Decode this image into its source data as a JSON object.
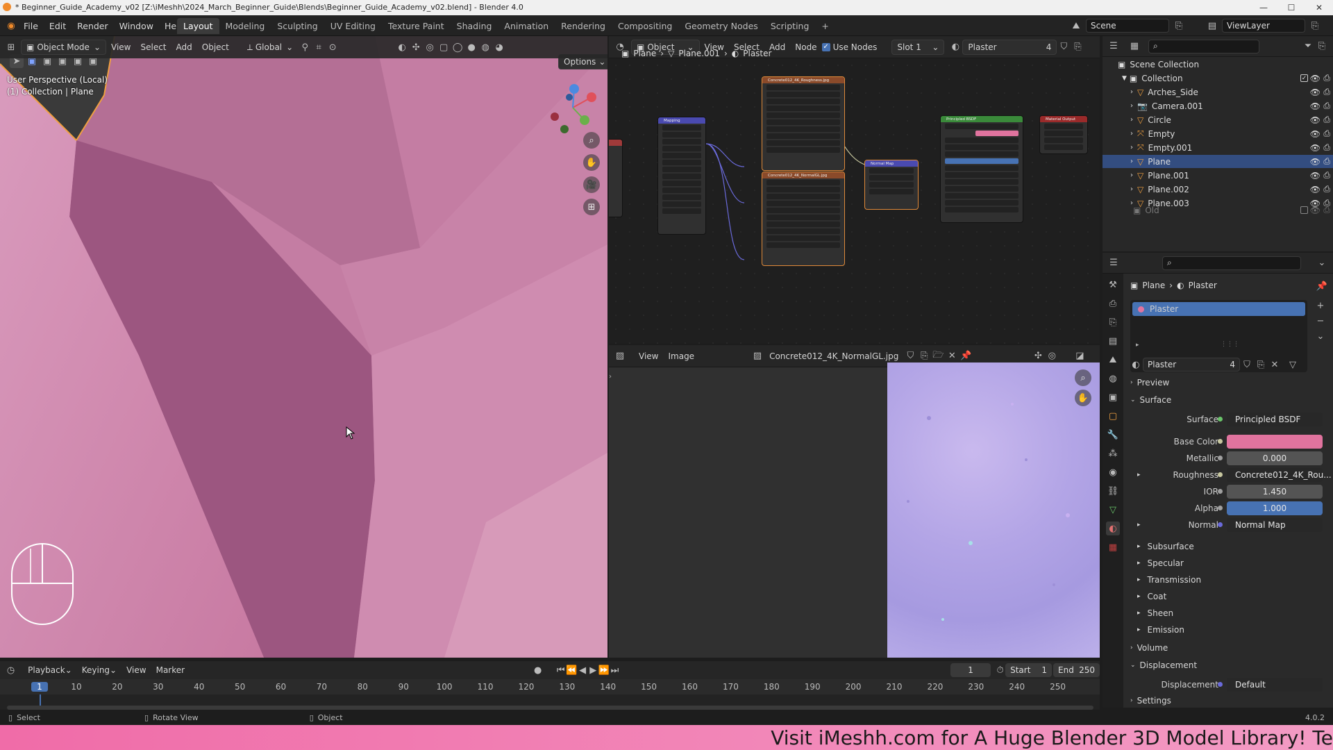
{
  "titlebar": {
    "text": "* Beginner_Guide_Academy_v02 [Z:\\iMeshh\\2024_March_Beginner_Guide\\Blends\\Beginner_Guide_Academy_v02.blend] - Blender 4.0"
  },
  "menu": [
    "File",
    "Edit",
    "Render",
    "Window",
    "Help"
  ],
  "workspaces": [
    "Layout",
    "Modeling",
    "Sculpting",
    "UV Editing",
    "Texture Paint",
    "Shading",
    "Animation",
    "Rendering",
    "Compositing",
    "Geometry Nodes",
    "Scripting"
  ],
  "scene": {
    "name": "Scene",
    "viewlayer": "ViewLayer"
  },
  "viewport": {
    "mode": "Object Mode",
    "menus": [
      "View",
      "Select",
      "Add",
      "Object"
    ],
    "transform": "Global",
    "options": "Options",
    "perspective": "User Perspective (Local)",
    "collection": "(1) Collection | Plane"
  },
  "node_editor": {
    "object_type": "Object",
    "menus": [
      "View",
      "Select",
      "Add",
      "Node"
    ],
    "use_nodes": "Use Nodes",
    "slot": "Slot 1",
    "material": "Plaster",
    "users": "4",
    "breadcrumb": [
      "Plane",
      "Plane.001",
      "Plaster"
    ],
    "nodes": {
      "mapping": "Mapping",
      "rough_tex": "Concrete012_4K_Roughness.jpg",
      "normal_tex": "Concrete012_4K_NormalGL.jpg",
      "normal_map": "Normal Map",
      "bsdf": "Principled BSDF",
      "output": "Material Output"
    }
  },
  "image_editor": {
    "menus": [
      "View",
      "Image"
    ],
    "image": "Concrete012_4K_NormalGL.jpg"
  },
  "outliner": {
    "root": "Scene Collection",
    "collection": "Collection",
    "items": [
      "Arches_Side",
      "Camera.001",
      "Circle",
      "Empty",
      "Empty.001",
      "Plane",
      "Plane.001",
      "Plane.002",
      "Plane.003"
    ],
    "old": "Old"
  },
  "properties": {
    "breadcrumb": [
      "Plane",
      "Plaster"
    ],
    "slot_material": "Plaster",
    "material_name": "Plaster",
    "users": "4",
    "preview": "Preview",
    "surface_section": "Surface",
    "fields": [
      {
        "label": "Surface",
        "value": "Principled BSDF"
      },
      {
        "label": "Base Color",
        "value": ""
      },
      {
        "label": "Metallic",
        "value": "0.000"
      },
      {
        "label": "Roughness",
        "value": "Concrete012_4K_Rou..."
      },
      {
        "label": "IOR",
        "value": "1.450"
      },
      {
        "label": "Alpha",
        "value": "1.000"
      },
      {
        "label": "Normal",
        "value": "Normal Map"
      }
    ],
    "subsections": [
      "Subsurface",
      "Specular",
      "Transmission",
      "Coat",
      "Sheen",
      "Emission"
    ],
    "volume": "Volume",
    "displacement_section": "Displacement",
    "displacement_label": "Displacement",
    "displacement_value": "Default",
    "settings": "Settings",
    "base_color_hex": "#e0739e"
  },
  "timeline": {
    "menus": [
      "Playback",
      "Keying",
      "View",
      "Marker"
    ],
    "current_frame": "1",
    "start_label": "Start",
    "start": "1",
    "end_label": "End",
    "end": "250",
    "ticks": [
      "1",
      "10",
      "20",
      "30",
      "40",
      "50",
      "60",
      "70",
      "80",
      "90",
      "100",
      "110",
      "120",
      "130",
      "140",
      "150",
      "160",
      "170",
      "180",
      "190",
      "200",
      "210",
      "220",
      "230",
      "240",
      "250"
    ]
  },
  "statusbar": {
    "items": [
      "Select",
      "Rotate View",
      "Object"
    ],
    "version": "4.0.2"
  },
  "banner": {
    "text": "Visit iMeshh.com for A Huge Blender 3D Model Library! Te"
  }
}
